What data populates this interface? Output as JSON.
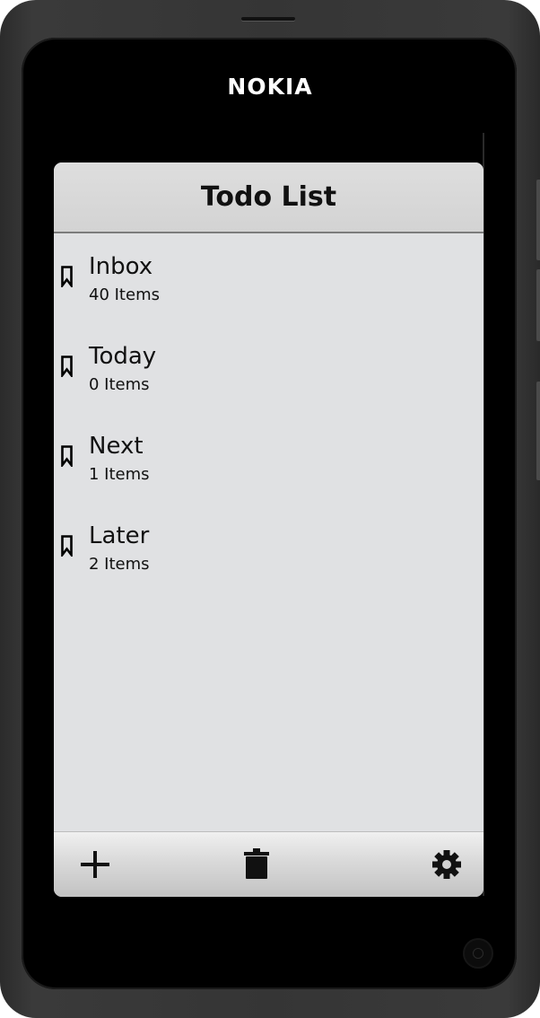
{
  "device": {
    "brand": "NOKIA"
  },
  "app": {
    "title": "Todo List"
  },
  "lists": [
    {
      "name": "Inbox",
      "count": "40 Items",
      "icon": "bookmark-icon"
    },
    {
      "name": "Today",
      "count": "0 Items",
      "icon": "bookmark-icon"
    },
    {
      "name": "Next",
      "count": "1 Items",
      "icon": "bookmark-icon"
    },
    {
      "name": "Later",
      "count": "2 Items",
      "icon": "bookmark-icon"
    }
  ],
  "toolbar": {
    "buttons": [
      {
        "icon": "plus-icon",
        "action": "add"
      },
      {
        "icon": "trash-icon",
        "action": "delete"
      },
      {
        "icon": "gear-icon",
        "action": "settings"
      }
    ]
  },
  "colors": {
    "screen_background": "#e0e1e3",
    "header_background": "#d3d3d3",
    "text": "#111111",
    "device_body": "#353535"
  }
}
